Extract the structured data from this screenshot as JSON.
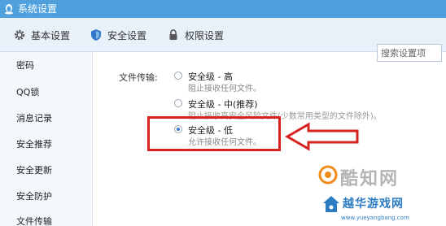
{
  "window": {
    "title": "系统设置"
  },
  "tabs": [
    {
      "label": "基本设置",
      "icon": "gear-icon"
    },
    {
      "label": "安全设置",
      "icon": "shield-icon",
      "active": true
    },
    {
      "label": "权限设置",
      "icon": "lock-icon"
    }
  ],
  "search": {
    "placeholder": "搜索设置项"
  },
  "sidebar": {
    "items": [
      {
        "label": "密码"
      },
      {
        "label": "QQ锁"
      },
      {
        "label": "消息记录"
      },
      {
        "label": "安全推荐"
      },
      {
        "label": "安全更新"
      },
      {
        "label": "安全防护"
      },
      {
        "label": "文件传输"
      }
    ]
  },
  "file_transfer": {
    "label": "文件传输:",
    "options": [
      {
        "title": "安全级 - 高",
        "desc": "阻止接收任何文件。",
        "checked": false
      },
      {
        "title": "安全级 - 中(推荐)",
        "desc": "阻止接收高安全风险文件(少数常用类型的文件除外)。",
        "checked": false
      },
      {
        "title": "安全级 - 低",
        "desc": "允许接收任何文件。",
        "checked": true
      }
    ]
  },
  "colors": {
    "titlebar": "#4fa0dc",
    "tabbar": "#e8f1fa",
    "annotation": "#d6231f",
    "watermark_blue": "#2c7cc4"
  },
  "watermarks": {
    "primary_text": "酷知网",
    "secondary_title": "越华游戏网",
    "secondary_url": "www.yueyangbang.com"
  }
}
